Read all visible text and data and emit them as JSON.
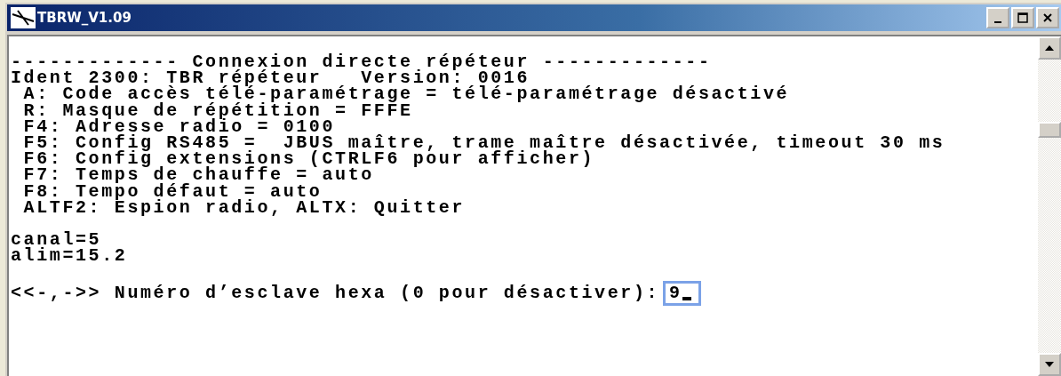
{
  "window": {
    "title": "TBRW_V1.09"
  },
  "console": {
    "groups": [
      [
        "------------- Connexion directe répéteur -------------",
        "Ident 2300: TBR répéteur   Version: 0016",
        " A: Code accès télé-paramétrage = télé-paramétrage désactivé",
        " R: Masque de répétition = FFFE",
        " F4: Adresse radio = 0100",
        " F5: Config RS485 =  JBUS maître, trame maître désactivée, timeout 30 ms",
        " F6: Config extensions (CTRLF6 pour afficher)",
        " F7: Temps de chauffe = auto",
        " F8: Tempo défaut = auto",
        " ALTF2: Espion radio, ALTX: Quitter"
      ],
      [
        "canal=5",
        "alim=15.2"
      ]
    ],
    "prompt": {
      "label": "<<-,->> Numéro d’esclave hexa (0 pour désactiver):",
      "value": "9"
    }
  }
}
